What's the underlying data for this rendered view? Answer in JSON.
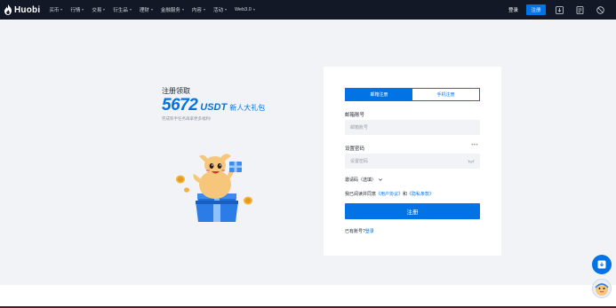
{
  "nav": {
    "logo_text": "Huobi",
    "items": [
      {
        "label": "买币",
        "has_caret": true
      },
      {
        "label": "行情",
        "has_caret": true
      },
      {
        "label": "交易",
        "has_caret": true
      },
      {
        "label": "衍生品",
        "has_caret": true
      },
      {
        "label": "理财",
        "has_caret": true
      },
      {
        "label": "金融服务",
        "has_caret": true
      },
      {
        "label": "内容",
        "has_caret": true
      },
      {
        "label": "活动",
        "has_caret": true
      },
      {
        "label": "Web3.0",
        "has_caret": true
      }
    ],
    "login_label": "登录",
    "register_label": "注册",
    "right_icons": [
      "download-icon",
      "document-icon",
      "language-icon"
    ]
  },
  "promo": {
    "title": "注册领取",
    "amount": "5672",
    "unit": "USDT",
    "gift_label": "新人大礼包",
    "subtitle": "完成新手任务再拿更多福利!"
  },
  "form": {
    "tab_email": "邮箱注册",
    "tab_phone": "手机注册",
    "email_label": "邮箱账号",
    "email_placeholder": "邮箱账号",
    "password_label": "设置密码",
    "password_placeholder": "设置密码",
    "password_dots": "•••",
    "invite_label": "邀请码（选填）",
    "agree_prefix": "我已阅读并同意",
    "agree_link1": "《用户协议》",
    "agree_and": "和",
    "agree_link2": "《隐私条款》",
    "submit_label": "注册",
    "have_account": "已有账号?",
    "login_link": "登录"
  },
  "colors": {
    "accent": "#0173e5",
    "nav_bg": "#121826",
    "page_bg": "#f1f3f6"
  }
}
